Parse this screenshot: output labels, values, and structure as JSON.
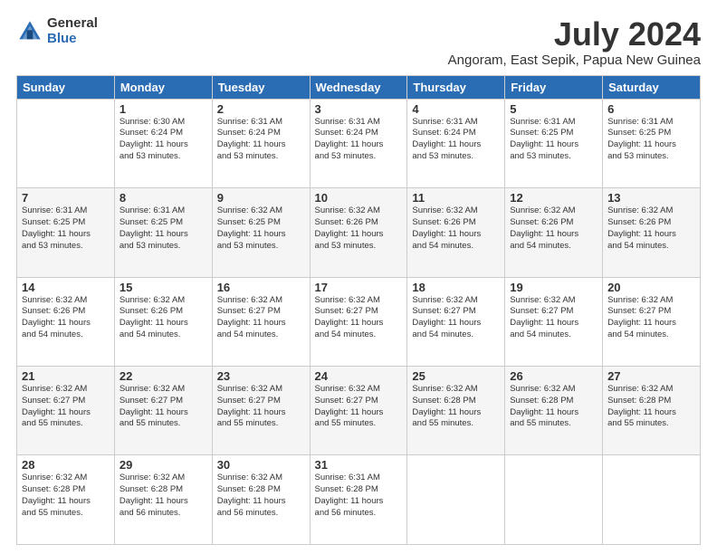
{
  "logo": {
    "general": "General",
    "blue": "Blue"
  },
  "title": "July 2024",
  "subtitle": "Angoram, East Sepik, Papua New Guinea",
  "days": [
    "Sunday",
    "Monday",
    "Tuesday",
    "Wednesday",
    "Thursday",
    "Friday",
    "Saturday"
  ],
  "weeks": [
    [
      {
        "num": "",
        "info": ""
      },
      {
        "num": "1",
        "info": "Sunrise: 6:30 AM\nSunset: 6:24 PM\nDaylight: 11 hours\nand 53 minutes."
      },
      {
        "num": "2",
        "info": "Sunrise: 6:31 AM\nSunset: 6:24 PM\nDaylight: 11 hours\nand 53 minutes."
      },
      {
        "num": "3",
        "info": "Sunrise: 6:31 AM\nSunset: 6:24 PM\nDaylight: 11 hours\nand 53 minutes."
      },
      {
        "num": "4",
        "info": "Sunrise: 6:31 AM\nSunset: 6:24 PM\nDaylight: 11 hours\nand 53 minutes."
      },
      {
        "num": "5",
        "info": "Sunrise: 6:31 AM\nSunset: 6:25 PM\nDaylight: 11 hours\nand 53 minutes."
      },
      {
        "num": "6",
        "info": "Sunrise: 6:31 AM\nSunset: 6:25 PM\nDaylight: 11 hours\nand 53 minutes."
      }
    ],
    [
      {
        "num": "7",
        "info": "Sunrise: 6:31 AM\nSunset: 6:25 PM\nDaylight: 11 hours\nand 53 minutes."
      },
      {
        "num": "8",
        "info": "Sunrise: 6:31 AM\nSunset: 6:25 PM\nDaylight: 11 hours\nand 53 minutes."
      },
      {
        "num": "9",
        "info": "Sunrise: 6:32 AM\nSunset: 6:25 PM\nDaylight: 11 hours\nand 53 minutes."
      },
      {
        "num": "10",
        "info": "Sunrise: 6:32 AM\nSunset: 6:26 PM\nDaylight: 11 hours\nand 53 minutes."
      },
      {
        "num": "11",
        "info": "Sunrise: 6:32 AM\nSunset: 6:26 PM\nDaylight: 11 hours\nand 54 minutes."
      },
      {
        "num": "12",
        "info": "Sunrise: 6:32 AM\nSunset: 6:26 PM\nDaylight: 11 hours\nand 54 minutes."
      },
      {
        "num": "13",
        "info": "Sunrise: 6:32 AM\nSunset: 6:26 PM\nDaylight: 11 hours\nand 54 minutes."
      }
    ],
    [
      {
        "num": "14",
        "info": "Sunrise: 6:32 AM\nSunset: 6:26 PM\nDaylight: 11 hours\nand 54 minutes."
      },
      {
        "num": "15",
        "info": "Sunrise: 6:32 AM\nSunset: 6:26 PM\nDaylight: 11 hours\nand 54 minutes."
      },
      {
        "num": "16",
        "info": "Sunrise: 6:32 AM\nSunset: 6:27 PM\nDaylight: 11 hours\nand 54 minutes."
      },
      {
        "num": "17",
        "info": "Sunrise: 6:32 AM\nSunset: 6:27 PM\nDaylight: 11 hours\nand 54 minutes."
      },
      {
        "num": "18",
        "info": "Sunrise: 6:32 AM\nSunset: 6:27 PM\nDaylight: 11 hours\nand 54 minutes."
      },
      {
        "num": "19",
        "info": "Sunrise: 6:32 AM\nSunset: 6:27 PM\nDaylight: 11 hours\nand 54 minutes."
      },
      {
        "num": "20",
        "info": "Sunrise: 6:32 AM\nSunset: 6:27 PM\nDaylight: 11 hours\nand 54 minutes."
      }
    ],
    [
      {
        "num": "21",
        "info": "Sunrise: 6:32 AM\nSunset: 6:27 PM\nDaylight: 11 hours\nand 55 minutes."
      },
      {
        "num": "22",
        "info": "Sunrise: 6:32 AM\nSunset: 6:27 PM\nDaylight: 11 hours\nand 55 minutes."
      },
      {
        "num": "23",
        "info": "Sunrise: 6:32 AM\nSunset: 6:27 PM\nDaylight: 11 hours\nand 55 minutes."
      },
      {
        "num": "24",
        "info": "Sunrise: 6:32 AM\nSunset: 6:27 PM\nDaylight: 11 hours\nand 55 minutes."
      },
      {
        "num": "25",
        "info": "Sunrise: 6:32 AM\nSunset: 6:28 PM\nDaylight: 11 hours\nand 55 minutes."
      },
      {
        "num": "26",
        "info": "Sunrise: 6:32 AM\nSunset: 6:28 PM\nDaylight: 11 hours\nand 55 minutes."
      },
      {
        "num": "27",
        "info": "Sunrise: 6:32 AM\nSunset: 6:28 PM\nDaylight: 11 hours\nand 55 minutes."
      }
    ],
    [
      {
        "num": "28",
        "info": "Sunrise: 6:32 AM\nSunset: 6:28 PM\nDaylight: 11 hours\nand 55 minutes."
      },
      {
        "num": "29",
        "info": "Sunrise: 6:32 AM\nSunset: 6:28 PM\nDaylight: 11 hours\nand 56 minutes."
      },
      {
        "num": "30",
        "info": "Sunrise: 6:32 AM\nSunset: 6:28 PM\nDaylight: 11 hours\nand 56 minutes."
      },
      {
        "num": "31",
        "info": "Sunrise: 6:31 AM\nSunset: 6:28 PM\nDaylight: 11 hours\nand 56 minutes."
      },
      {
        "num": "",
        "info": ""
      },
      {
        "num": "",
        "info": ""
      },
      {
        "num": "",
        "info": ""
      }
    ]
  ]
}
